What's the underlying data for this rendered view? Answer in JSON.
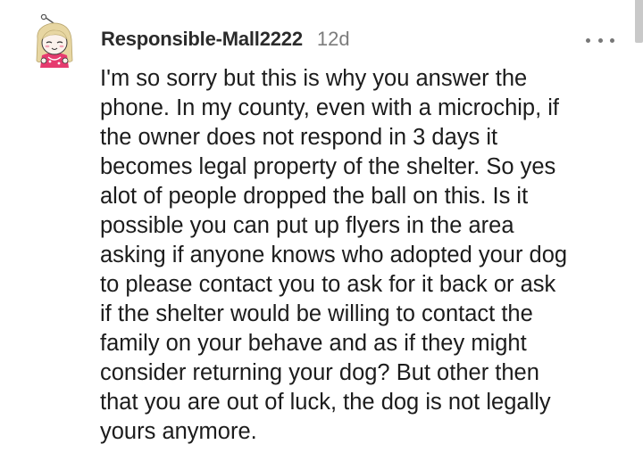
{
  "comment": {
    "author": "Responsible-Mall2222",
    "age": "12d",
    "avatar": "snoo-avatar-icon",
    "more_options": "more-options-icon",
    "body": "I'm so sorry but this is why you answer the\nphone. In my county, even with a microchip, if\nthe owner does not respond in 3 days it\nbecomes legal property of the shelter. So yes\nalot of people dropped the ball on this. Is it\npossible you can put up flyers in the area\nasking if anyone knows who adopted your dog\nto please contact you to ask for it back or ask\nif the shelter would be willing to contact the\nfamily on your behave and as if they might\nconsider returning your dog? But other then\nthat you are out of luck, the dog is not legally\nyours anymore."
  },
  "colors": {
    "username": "#2b2b2b",
    "meta": "#7c7c7c",
    "body_text": "#1c1c1c",
    "avatar_hair": "#e7d6a2",
    "avatar_shirt": "#e63b6f"
  }
}
